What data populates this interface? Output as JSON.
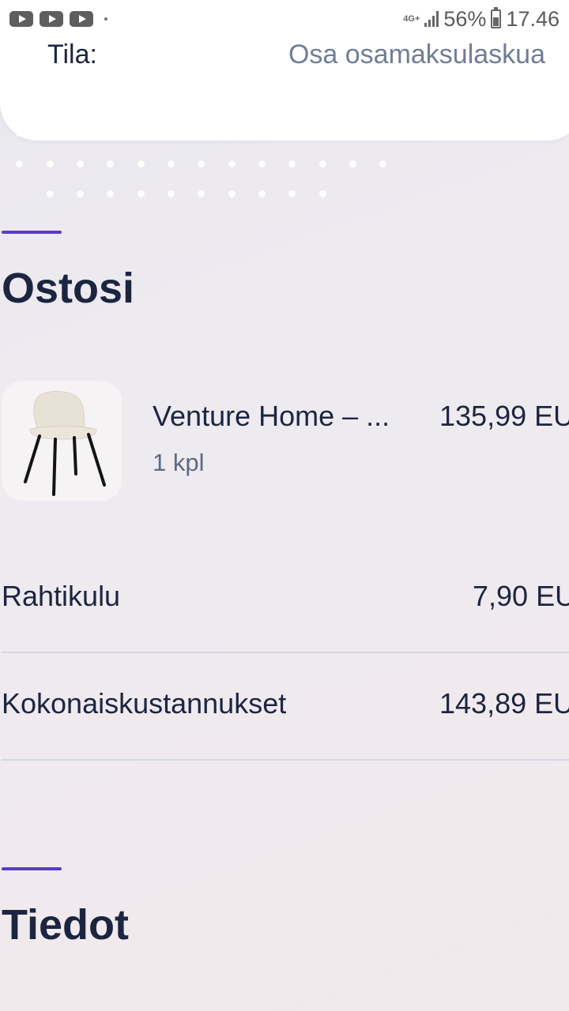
{
  "status_bar": {
    "network": "4G+",
    "battery": "56%",
    "time": "17.46"
  },
  "order_status": {
    "label": "Tila:",
    "value": "Osa osamaksulaskua"
  },
  "purchases": {
    "title": "Ostosi",
    "items": [
      {
        "name": "Venture Home – ...",
        "quantity": "1 kpl",
        "price": "135,99 EU"
      }
    ],
    "shipping_label": "Rahtikulu",
    "shipping_value": "7,90 EU",
    "total_label": "Kokonaiskustannukset",
    "total_value": "143,89 EU"
  },
  "details": {
    "title": "Tiedot"
  },
  "colors": {
    "accent": "#5b3cc4",
    "heading": "#1c2540",
    "muted": "#6f7e96"
  }
}
